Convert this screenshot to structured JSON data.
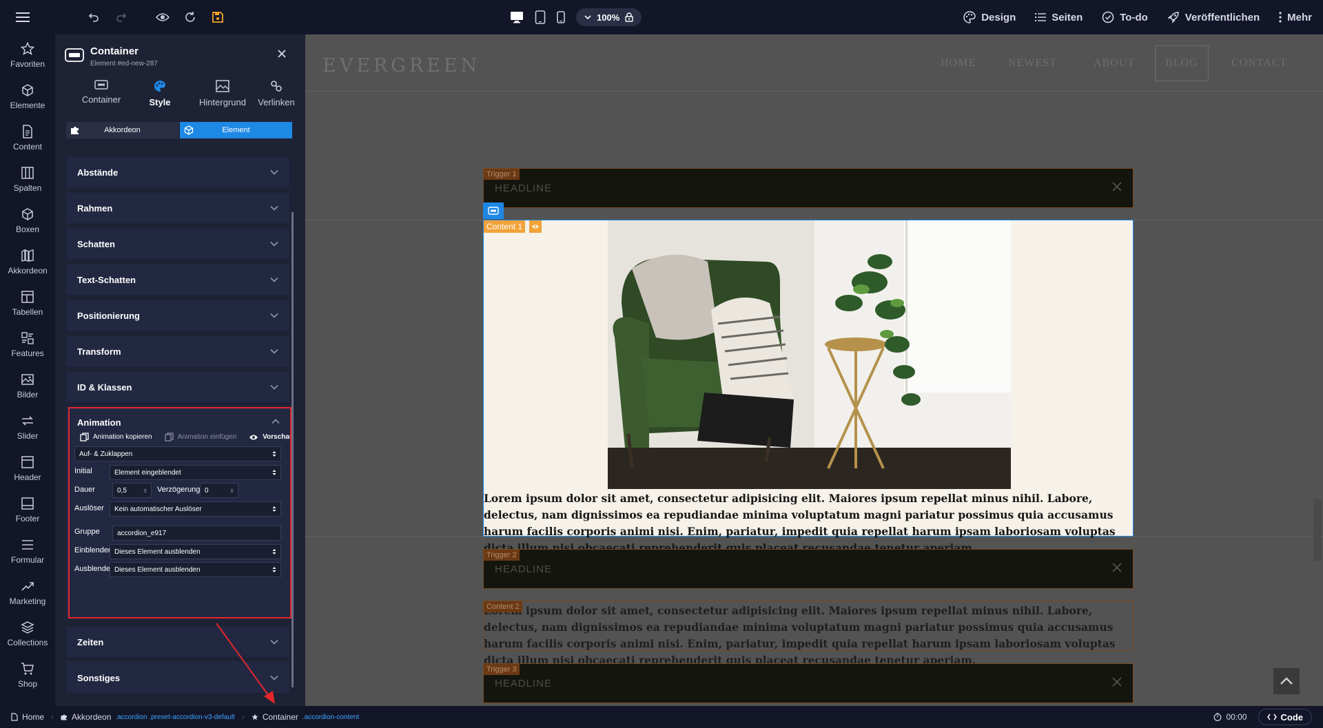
{
  "topbar": {
    "zoom": "100%",
    "right_items": [
      "Design",
      "Seiten",
      "To-do",
      "Veröffentlichen",
      "Mehr"
    ],
    "icons": [
      "menu-icon",
      "undo-icon",
      "redo-icon",
      "preview-eye-icon",
      "refresh-icon",
      "save-icon",
      "desktop-icon",
      "tablet-icon",
      "mobile-icon",
      "lock-icon"
    ]
  },
  "sidebar": {
    "items": [
      {
        "label": "Favoriten",
        "icon": "star-icon"
      },
      {
        "label": "Elemente",
        "icon": "cube-icon"
      },
      {
        "label": "Content",
        "icon": "document-icon"
      },
      {
        "label": "Spalten",
        "icon": "columns-icon"
      },
      {
        "label": "Boxen",
        "icon": "box-icon"
      },
      {
        "label": "Akkordeon",
        "icon": "accordion-icon"
      },
      {
        "label": "Tabellen",
        "icon": "table-icon"
      },
      {
        "label": "Features",
        "icon": "features-icon"
      },
      {
        "label": "Bilder",
        "icon": "image-icon"
      },
      {
        "label": "Slider",
        "icon": "slider-icon"
      },
      {
        "label": "Header",
        "icon": "header-icon"
      },
      {
        "label": "Footer",
        "icon": "footer-icon"
      },
      {
        "label": "Formular",
        "icon": "form-icon"
      },
      {
        "label": "Marketing",
        "icon": "marketing-icon"
      },
      {
        "label": "Collections",
        "icon": "layers-icon"
      },
      {
        "label": "Shop",
        "icon": "cart-icon"
      }
    ]
  },
  "panel": {
    "title": "Container",
    "subtitle": "Element #ed-new-287",
    "tabs": [
      {
        "label": "Container",
        "active": false
      },
      {
        "label": "Style",
        "active": true
      },
      {
        "label": "Hintergrund",
        "active": false
      },
      {
        "label": "Verlinken",
        "active": false
      }
    ],
    "segments": [
      "Akkordeon",
      "Element"
    ],
    "sections": [
      "Abstände",
      "Rahmen",
      "Schatten",
      "Text-Schatten",
      "Positionierung",
      "Transform",
      "ID & Klassen"
    ],
    "sections_after": [
      "Zeiten",
      "Sonstiges"
    ],
    "animation": {
      "title": "Animation",
      "copy": "Animation kopieren",
      "paste": "Animation einfügen",
      "preview": "Vorschau",
      "type": "Auf- & Zuklappen",
      "initial_label": "Initial",
      "initial_value": "Element eingeblendet",
      "dauer_label": "Dauer",
      "dauer_value": "0,5",
      "dauer_unit": "s",
      "verz_label": "Verzögerung",
      "verz_value": "0",
      "verz_unit": "s",
      "trigger_label": "Auslöser",
      "trigger_value": "Kein automatischer Auslöser",
      "gruppe_label": "Gruppe",
      "gruppe_value": "accordion_e917",
      "einblenden_label": "Einblenden",
      "einblenden_value": "Dieses Element ausblenden",
      "ausblenden_label": "Ausblenden",
      "ausblenden_value": "Dieses Element ausblenden"
    }
  },
  "site": {
    "logo": "EVERGREEN",
    "nav": [
      "HOME",
      "NEWEST",
      "ABOUT",
      "BLOG",
      "CONTACT"
    ],
    "triggers": [
      {
        "tag": "Trigger 1",
        "headline": "HEADLINE"
      },
      {
        "tag": "Trigger 2",
        "headline": "HEADLINE"
      },
      {
        "tag": "Trigger 3",
        "headline": "HEADLINE"
      }
    ],
    "content1_tag": "Content 1",
    "content2_tag": "Content 2",
    "paragraph": "Lorem ipsum dolor sit amet, consectetur adipisicing elit. Maiores ipsum repellat minus nihil. Labore, delectus, nam dignissimos ea repudiandae minima voluptatum magni pariatur possimus quia accusamus harum facilis corporis animi nisi. Enim, pariatur, impedit quia repellat harum ipsam laboriosam voluptas dicta illum nisi obcaecati reprehenderit quis placeat recusandae tenetur aperiam.",
    "paragraph2": "Lorem ipsum dolor sit amet, consectetur adipisicing elit. Maiores ipsum repellat minus nihil. Labore, delectus, nam dignissimos ea repudiandae minima voluptatum magni pariatur possimus quia accusamus harum facilis corporis animi nisi. Enim, pariatur, impedit quia repellat harum ipsam laboriosam voluptas dicta illum nisi obcaecati reprehenderit quis placeat recusandae tenetur aperiam."
  },
  "bottombar": {
    "home": "Home",
    "crumb1": "Akkordeon",
    "crumb1_classes": ".accordion .preset-accordion-v3-default",
    "crumb2": "Container",
    "crumb2_classes": ".accordion-content",
    "timer": "00:00",
    "code": "Code"
  },
  "colors": {
    "accent": "#1e88e5",
    "highlight": "#e3262d",
    "save": "#f5a623",
    "content_tag": "#f2a33a"
  }
}
